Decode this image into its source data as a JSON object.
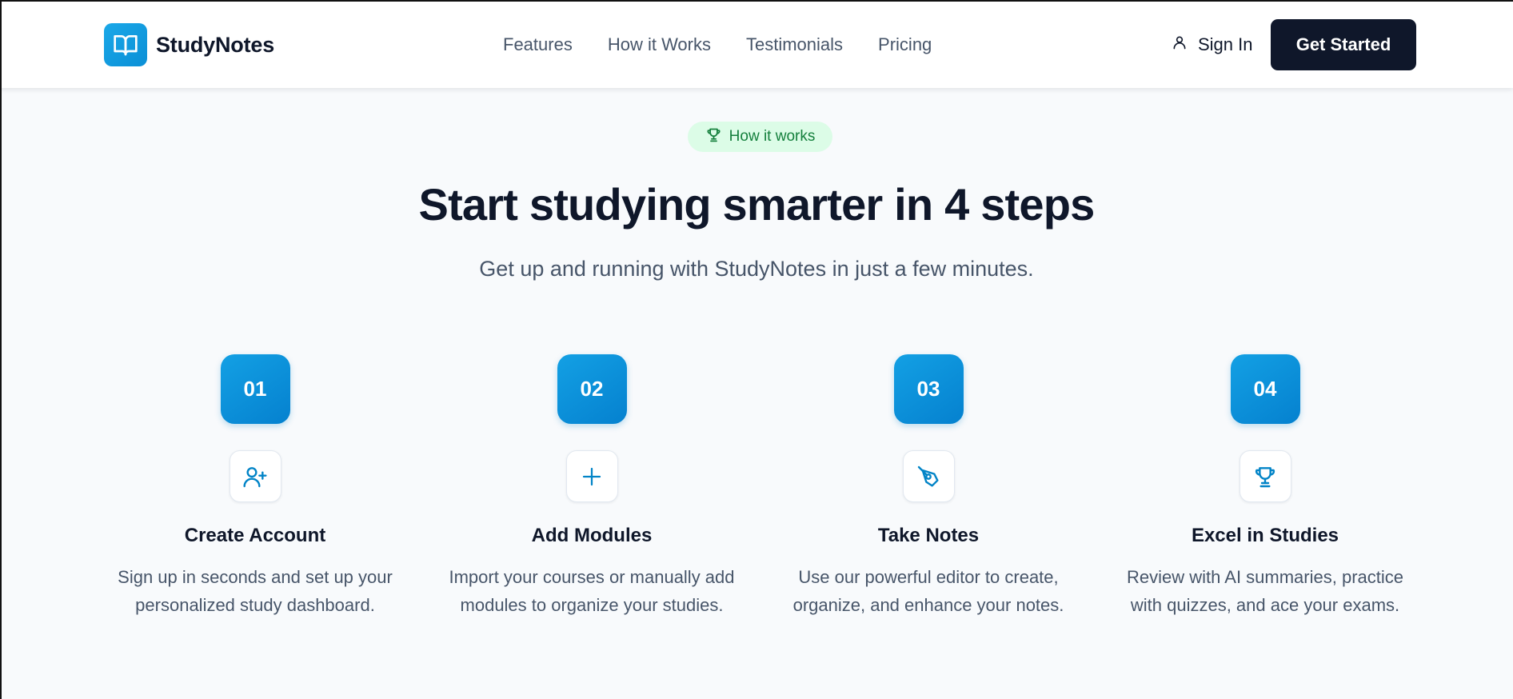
{
  "brand": {
    "name": "StudyNotes",
    "logo_icon": "open-book-icon",
    "accent_color": "#0b8fd6"
  },
  "nav": {
    "items": [
      {
        "label": "Features"
      },
      {
        "label": "How it Works"
      },
      {
        "label": "Testimonials"
      },
      {
        "label": "Pricing"
      }
    ],
    "sign_in_label": "Sign In",
    "sign_in_icon": "user-icon",
    "cta_label": "Get Started"
  },
  "hero": {
    "badge_label": "How it works",
    "badge_icon": "trophy-icon",
    "title": "Start studying smarter in 4 steps",
    "subtitle": "Get up and running with StudyNotes in just a few minutes."
  },
  "steps": [
    {
      "number": "01",
      "icon": "user-plus-icon",
      "title": "Create Account",
      "desc_line1": "Sign up in seconds and set up your",
      "desc_line2": "personalized study dashboard."
    },
    {
      "number": "02",
      "icon": "plus-icon",
      "title": "Add Modules",
      "desc_line1": "Import your courses or manually add",
      "desc_line2": "modules to organize your studies."
    },
    {
      "number": "03",
      "icon": "pen-tool-icon",
      "title": "Take Notes",
      "desc_line1": "Use our powerful editor to create,",
      "desc_line2": "organize, and enhance your notes."
    },
    {
      "number": "04",
      "icon": "trophy-icon",
      "title": "Excel in Studies",
      "desc_line1": "Review with AI summaries, practice",
      "desc_line2": "with quizzes, and ace your exams."
    }
  ]
}
